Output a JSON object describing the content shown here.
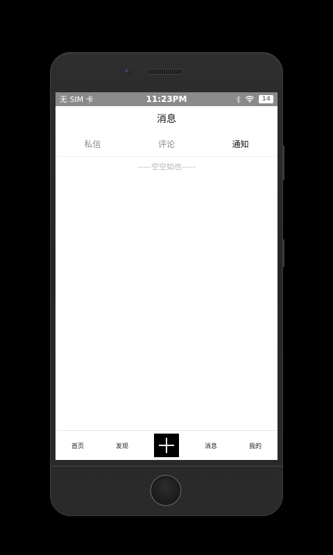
{
  "status_bar": {
    "carrier": "无 SIM 卡",
    "time": "11:23PM",
    "battery": "14"
  },
  "header": {
    "title": "消息"
  },
  "tabs": [
    {
      "label": "私信",
      "active": false
    },
    {
      "label": "评论",
      "active": false
    },
    {
      "label": "通知",
      "active": true
    }
  ],
  "content": {
    "empty_text": "-----空空如也-----"
  },
  "tabbar": {
    "items": [
      {
        "label": "首页"
      },
      {
        "label": "发现"
      },
      {
        "label": "消息"
      },
      {
        "label": "我的"
      }
    ],
    "add_icon": "plus-icon"
  }
}
